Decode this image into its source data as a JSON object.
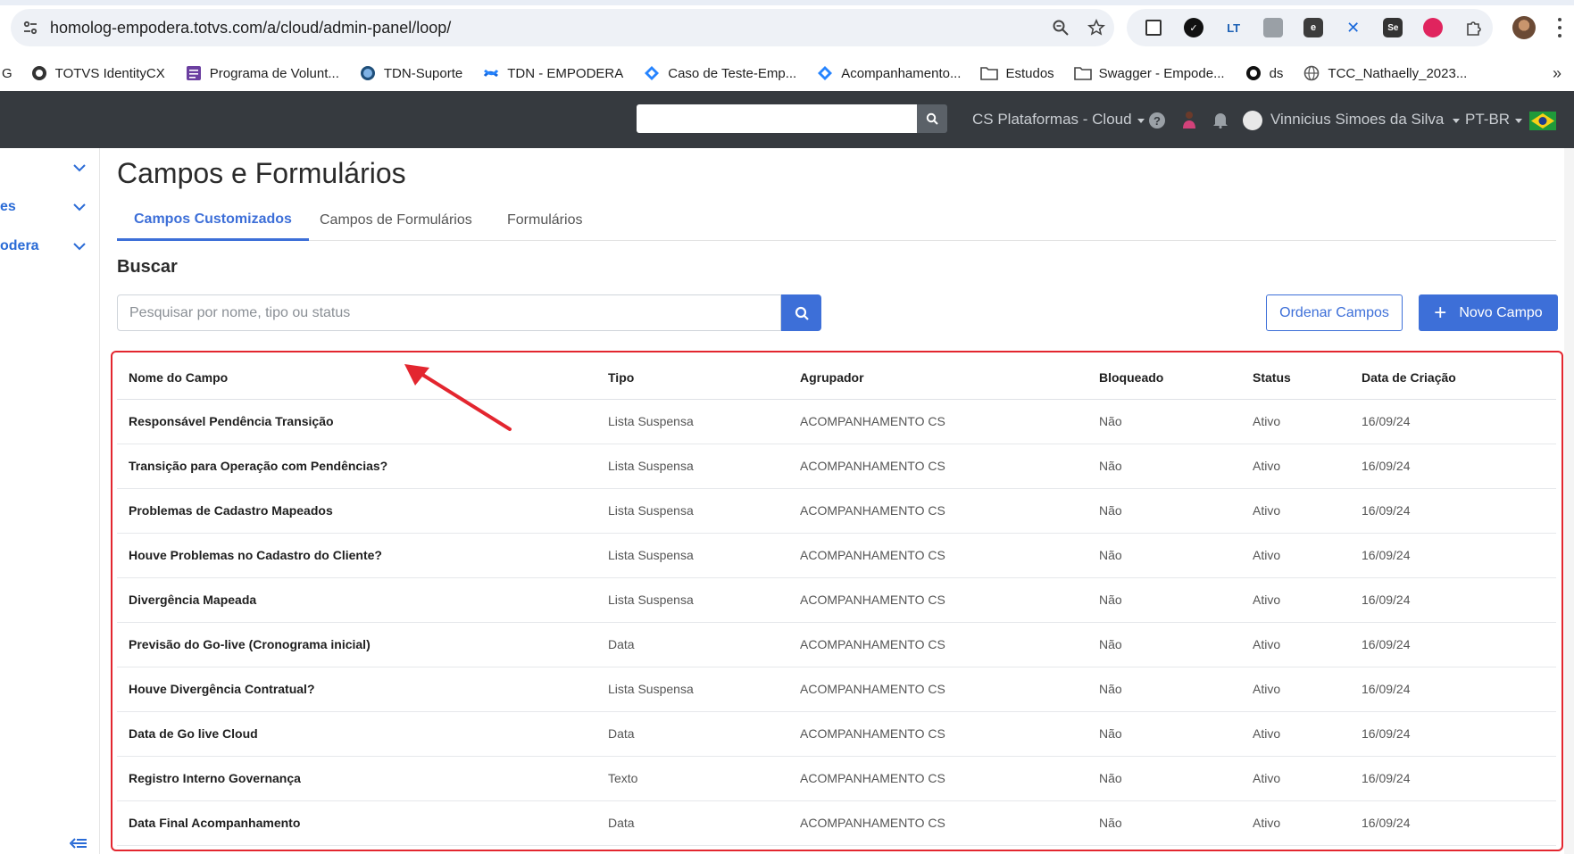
{
  "browser": {
    "url": "homolog-empodera.totvs.com/a/cloud/admin-panel/loop/",
    "bookmarks_prefix": "G",
    "bookmarks": [
      {
        "label": "TOTVS IdentityCX",
        "icon": "identity-icon"
      },
      {
        "label": "Programa de Volunt...",
        "icon": "form-icon"
      },
      {
        "label": "TDN-Suporte",
        "icon": "globe-icon"
      },
      {
        "label": "TDN - EMPODERA",
        "icon": "confluence-icon"
      },
      {
        "label": "Caso de Teste-Emp...",
        "icon": "jira-icon"
      },
      {
        "label": "Acompanhamento...",
        "icon": "jira-icon"
      },
      {
        "label": "Estudos",
        "icon": "folder-icon"
      },
      {
        "label": "Swagger - Empode...",
        "icon": "folder-icon"
      },
      {
        "label": "ds",
        "icon": "identity-icon"
      },
      {
        "label": "TCC_Nathaelly_2023...",
        "icon": "globe-icon"
      }
    ],
    "bookmarks_more": "»"
  },
  "appbar": {
    "organization": "CS Plataformas - Cloud",
    "help": "?",
    "user_name": "Vinnicius Simoes da Silva",
    "language": "PT-BR"
  },
  "sidebar": {
    "items": [
      {
        "label": ""
      },
      {
        "label": "es"
      },
      {
        "label": "odera"
      }
    ]
  },
  "main": {
    "title": "Campos e Formulários",
    "tabs": [
      {
        "label": "Campos Customizados",
        "active": true
      },
      {
        "label": "Campos de Formulários",
        "active": false
      },
      {
        "label": "Formulários",
        "active": false
      }
    ],
    "search_heading": "Buscar",
    "search_placeholder": "Pesquisar por nome, tipo ou status",
    "order_button": "Ordenar Campos",
    "new_button": "Novo Campo",
    "new_button_icon": "+",
    "table": {
      "headers": [
        "Nome do Campo",
        "Tipo",
        "Agrupador",
        "Bloqueado",
        "Status",
        "Data de Criação"
      ],
      "rows": [
        [
          "Responsável Pendência Transição",
          "Lista Suspensa",
          "ACOMPANHAMENTO CS",
          "Não",
          "Ativo",
          "16/09/24"
        ],
        [
          "Transição para Operação com Pendências?",
          "Lista Suspensa",
          "ACOMPANHAMENTO CS",
          "Não",
          "Ativo",
          "16/09/24"
        ],
        [
          "Problemas de Cadastro Mapeados",
          "Lista Suspensa",
          "ACOMPANHAMENTO CS",
          "Não",
          "Ativo",
          "16/09/24"
        ],
        [
          "Houve Problemas no Cadastro do Cliente?",
          "Lista Suspensa",
          "ACOMPANHAMENTO CS",
          "Não",
          "Ativo",
          "16/09/24"
        ],
        [
          "Divergência Mapeada",
          "Lista Suspensa",
          "ACOMPANHAMENTO CS",
          "Não",
          "Ativo",
          "16/09/24"
        ],
        [
          "Previsão do Go-live (Cronograma inicial)",
          "Data",
          "ACOMPANHAMENTO CS",
          "Não",
          "Ativo",
          "16/09/24"
        ],
        [
          "Houve Divergência Contratual?",
          "Lista Suspensa",
          "ACOMPANHAMENTO CS",
          "Não",
          "Ativo",
          "16/09/24"
        ],
        [
          "Data de Go live Cloud",
          "Data",
          "ACOMPANHAMENTO CS",
          "Não",
          "Ativo",
          "16/09/24"
        ],
        [
          "Registro Interno Governança",
          "Texto",
          "ACOMPANHAMENTO CS",
          "Não",
          "Ativo",
          "16/09/24"
        ],
        [
          "Data Final Acompanhamento",
          "Data",
          "ACOMPANHAMENTO CS",
          "Não",
          "Ativo",
          "16/09/24"
        ]
      ]
    }
  },
  "colors": {
    "accent": "#3d6fd8",
    "header_bg": "#363a3f",
    "annotation": "#e3262f"
  }
}
